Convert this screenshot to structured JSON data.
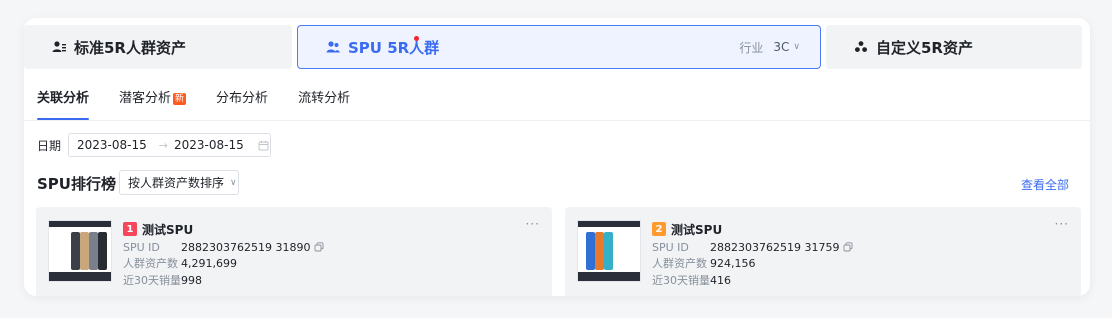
{
  "asset_cards": {
    "standard": {
      "label": "标准5R人群资产",
      "icon": "group-icon"
    },
    "spu": {
      "label": "SPU 5R人群",
      "icon": "user-group-icon",
      "industry_label": "行业",
      "industry_value": "3C"
    },
    "custom": {
      "label": "自定义5R资产",
      "icon": "custom-group-icon"
    }
  },
  "tabs": [
    {
      "label": "关联分析",
      "active": true
    },
    {
      "label": "潜客分析",
      "badge": "新"
    },
    {
      "label": "分布分析"
    },
    {
      "label": "流转分析"
    }
  ],
  "date_filter": {
    "label": "日期",
    "start": "2023-08-15",
    "end": "2023-08-15"
  },
  "ranking": {
    "title": "SPU排行榜",
    "sort_label": "按人群资产数排序",
    "view_all": "查看全部"
  },
  "products": [
    {
      "rank": "1",
      "name": "测试SPU",
      "spu_id_label": "SPU ID",
      "spu_id": "2882303762519 31890",
      "assets_label": "人群资产数",
      "assets": "4,291,699",
      "sales_label": "近30天销量",
      "sales": "998"
    },
    {
      "rank": "2",
      "name": "测试SPU",
      "spu_id_label": "SPU ID",
      "spu_id": "2882303762519 31759",
      "assets_label": "人群资产数",
      "assets": "924,156",
      "sales_label": "近30天销量",
      "sales": "416"
    }
  ],
  "colors": {
    "accent": "#3a6cf2",
    "badge_new": "#ff5a1f",
    "rank1": "#f5465c",
    "rank2": "#ff9a2e"
  }
}
